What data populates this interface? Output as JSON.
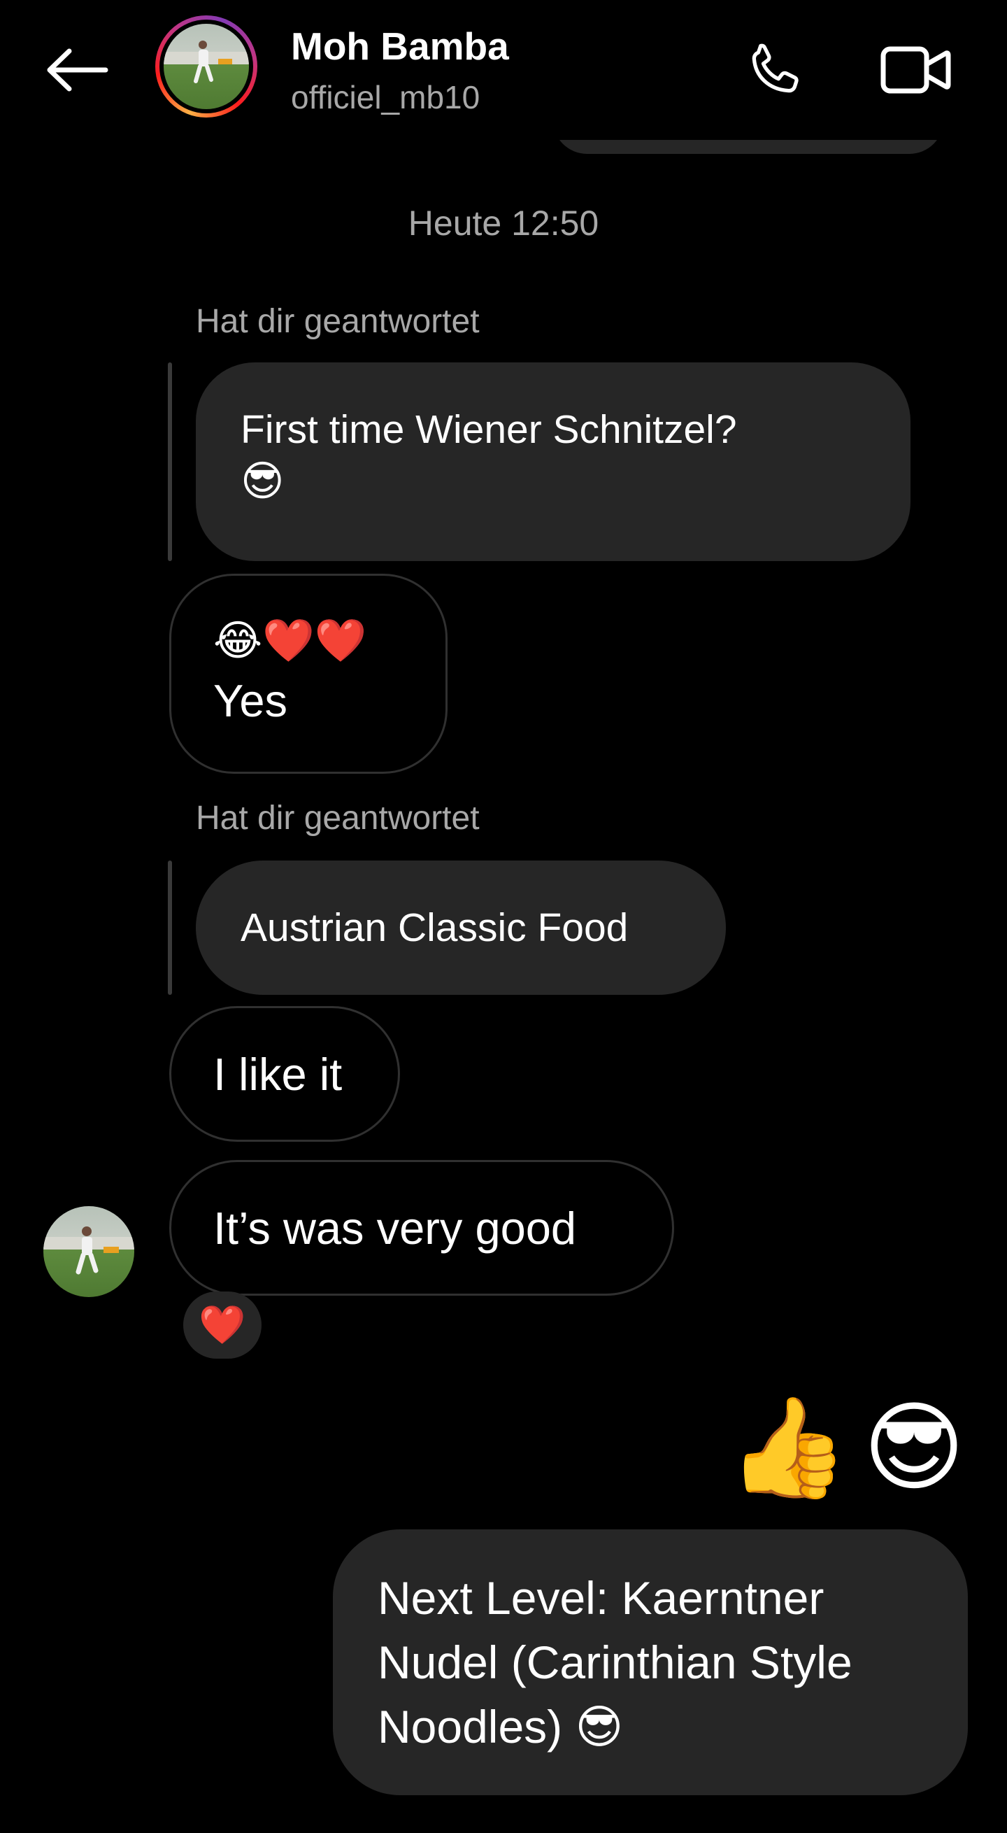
{
  "header": {
    "name": "Moh Bamba",
    "username": "officiel_mb10",
    "back_icon": "arrow-left-icon",
    "call_icon": "phone-icon",
    "video_icon": "video-camera-icon",
    "story_ring_colors": [
      "#fcb045",
      "#fd1d1d",
      "#c13584",
      "#833ab4"
    ]
  },
  "timestamp": "Heute 12:50",
  "messages": [
    {
      "reply_label": "Hat dir geantwortet",
      "quoted_text": "First time Wiener Schnitzel?",
      "quoted_emoji": "😎",
      "reply_emojis": "😂❤️❤️",
      "reply_text": "Yes"
    },
    {
      "reply_label": "Hat dir geantwortet",
      "quoted_text": "Austrian Classic Food",
      "reply_text": "I like it"
    },
    {
      "text": "It’s was very good",
      "reaction": "❤️"
    }
  ],
  "outgoing": {
    "emojis": [
      "👍",
      "😎"
    ],
    "lines": [
      "Next Level: Kaerntner",
      "Nudel (Carinthian Style",
      "Noodles) 😎"
    ]
  },
  "colors": {
    "background": "#000000",
    "bubble": "#262626",
    "muted_text": "#a8a8a8"
  }
}
